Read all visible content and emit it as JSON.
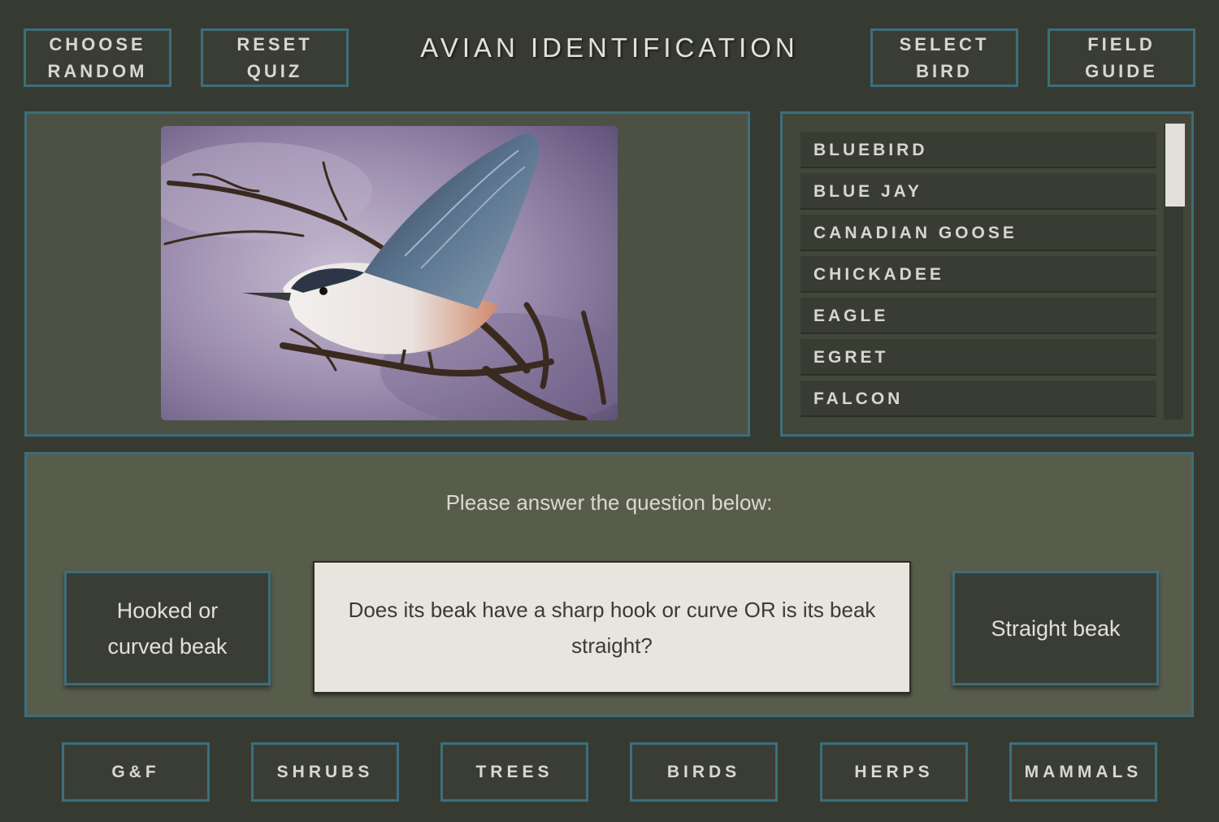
{
  "header": {
    "title": "AVIAN IDENTIFICATION",
    "choose_random": [
      "CHOOSE",
      "RANDOM"
    ],
    "reset_quiz": [
      "RESET",
      "QUIZ"
    ],
    "select_bird": [
      "SELECT",
      "BIRD"
    ],
    "field_guide": [
      "FIELD",
      "GUIDE"
    ]
  },
  "image_panel": {
    "picture": "bird-illustration-nuthatch-on-branch"
  },
  "bird_list": {
    "items": [
      "BLUEBIRD",
      "BLUE JAY",
      "CANADIAN GOOSE",
      "CHICKADEE",
      "EAGLE",
      "EGRET",
      "FALCON"
    ],
    "scroll_position": 0.0
  },
  "quiz": {
    "prompt": "Please answer the question below:",
    "question": "Does its beak have a sharp hook or curve OR is its beak straight?",
    "answer_left": "Hooked or curved beak",
    "answer_right": "Straight beak"
  },
  "footer_nav": [
    "G&F",
    "SHRUBS",
    "TREES",
    "BIRDS",
    "HERPS",
    "MAMMALS"
  ],
  "colors": {
    "background": "#363a31",
    "accent_border": "#3b6f7d",
    "panel": "#4c5143",
    "question_bg": "#e8e5df"
  }
}
